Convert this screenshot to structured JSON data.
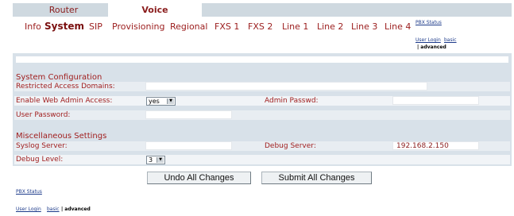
{
  "main_tabs": [
    {
      "label": "Router",
      "active": false
    },
    {
      "label": "Voice",
      "active": true
    }
  ],
  "sub_tabs": [
    {
      "label": "Info"
    },
    {
      "label": "System",
      "active": true
    },
    {
      "label": "SIP"
    },
    {
      "label": "Provisioning"
    },
    {
      "label": "Regional"
    },
    {
      "label": "FXS 1"
    },
    {
      "label": "FXS 2"
    },
    {
      "label": "Line 1"
    },
    {
      "label": "Line 2"
    },
    {
      "label": "Line 3"
    },
    {
      "label": "Line 4"
    }
  ],
  "top_links": {
    "pbx_status": "PBX Status",
    "user_login": "User Login",
    "basic": "basic",
    "advanced": "| advanced"
  },
  "system_config": {
    "title": "System Configuration",
    "restricted_access_label": "Restricted Access Domains:",
    "restricted_access_value": "",
    "web_admin_label": "Enable Web Admin Access:",
    "web_admin_value": "yes",
    "admin_passwd_label": "Admin Passwd:",
    "admin_passwd_value": "",
    "user_password_label": "User Password:",
    "user_password_value": ""
  },
  "misc_settings": {
    "title": "Miscellaneous Settings",
    "syslog_label": "Syslog Server:",
    "syslog_value": "",
    "debug_server_label": "Debug Server:",
    "debug_server_value": "192.168.2.150",
    "debug_level_label": "Debug Level:",
    "debug_level_value": "3"
  },
  "buttons": {
    "undo": "Undo All Changes",
    "submit": "Submit All Changes"
  },
  "bottom_links": {
    "pbx_status": "PBX Status",
    "user_login": "User Login",
    "basic": "basic",
    "advanced": "| advanced"
  },
  "colors": {
    "label_red": "#a11f1f",
    "panel_bg": "#d8e1e9",
    "link_blue": "#1c3a8a"
  }
}
